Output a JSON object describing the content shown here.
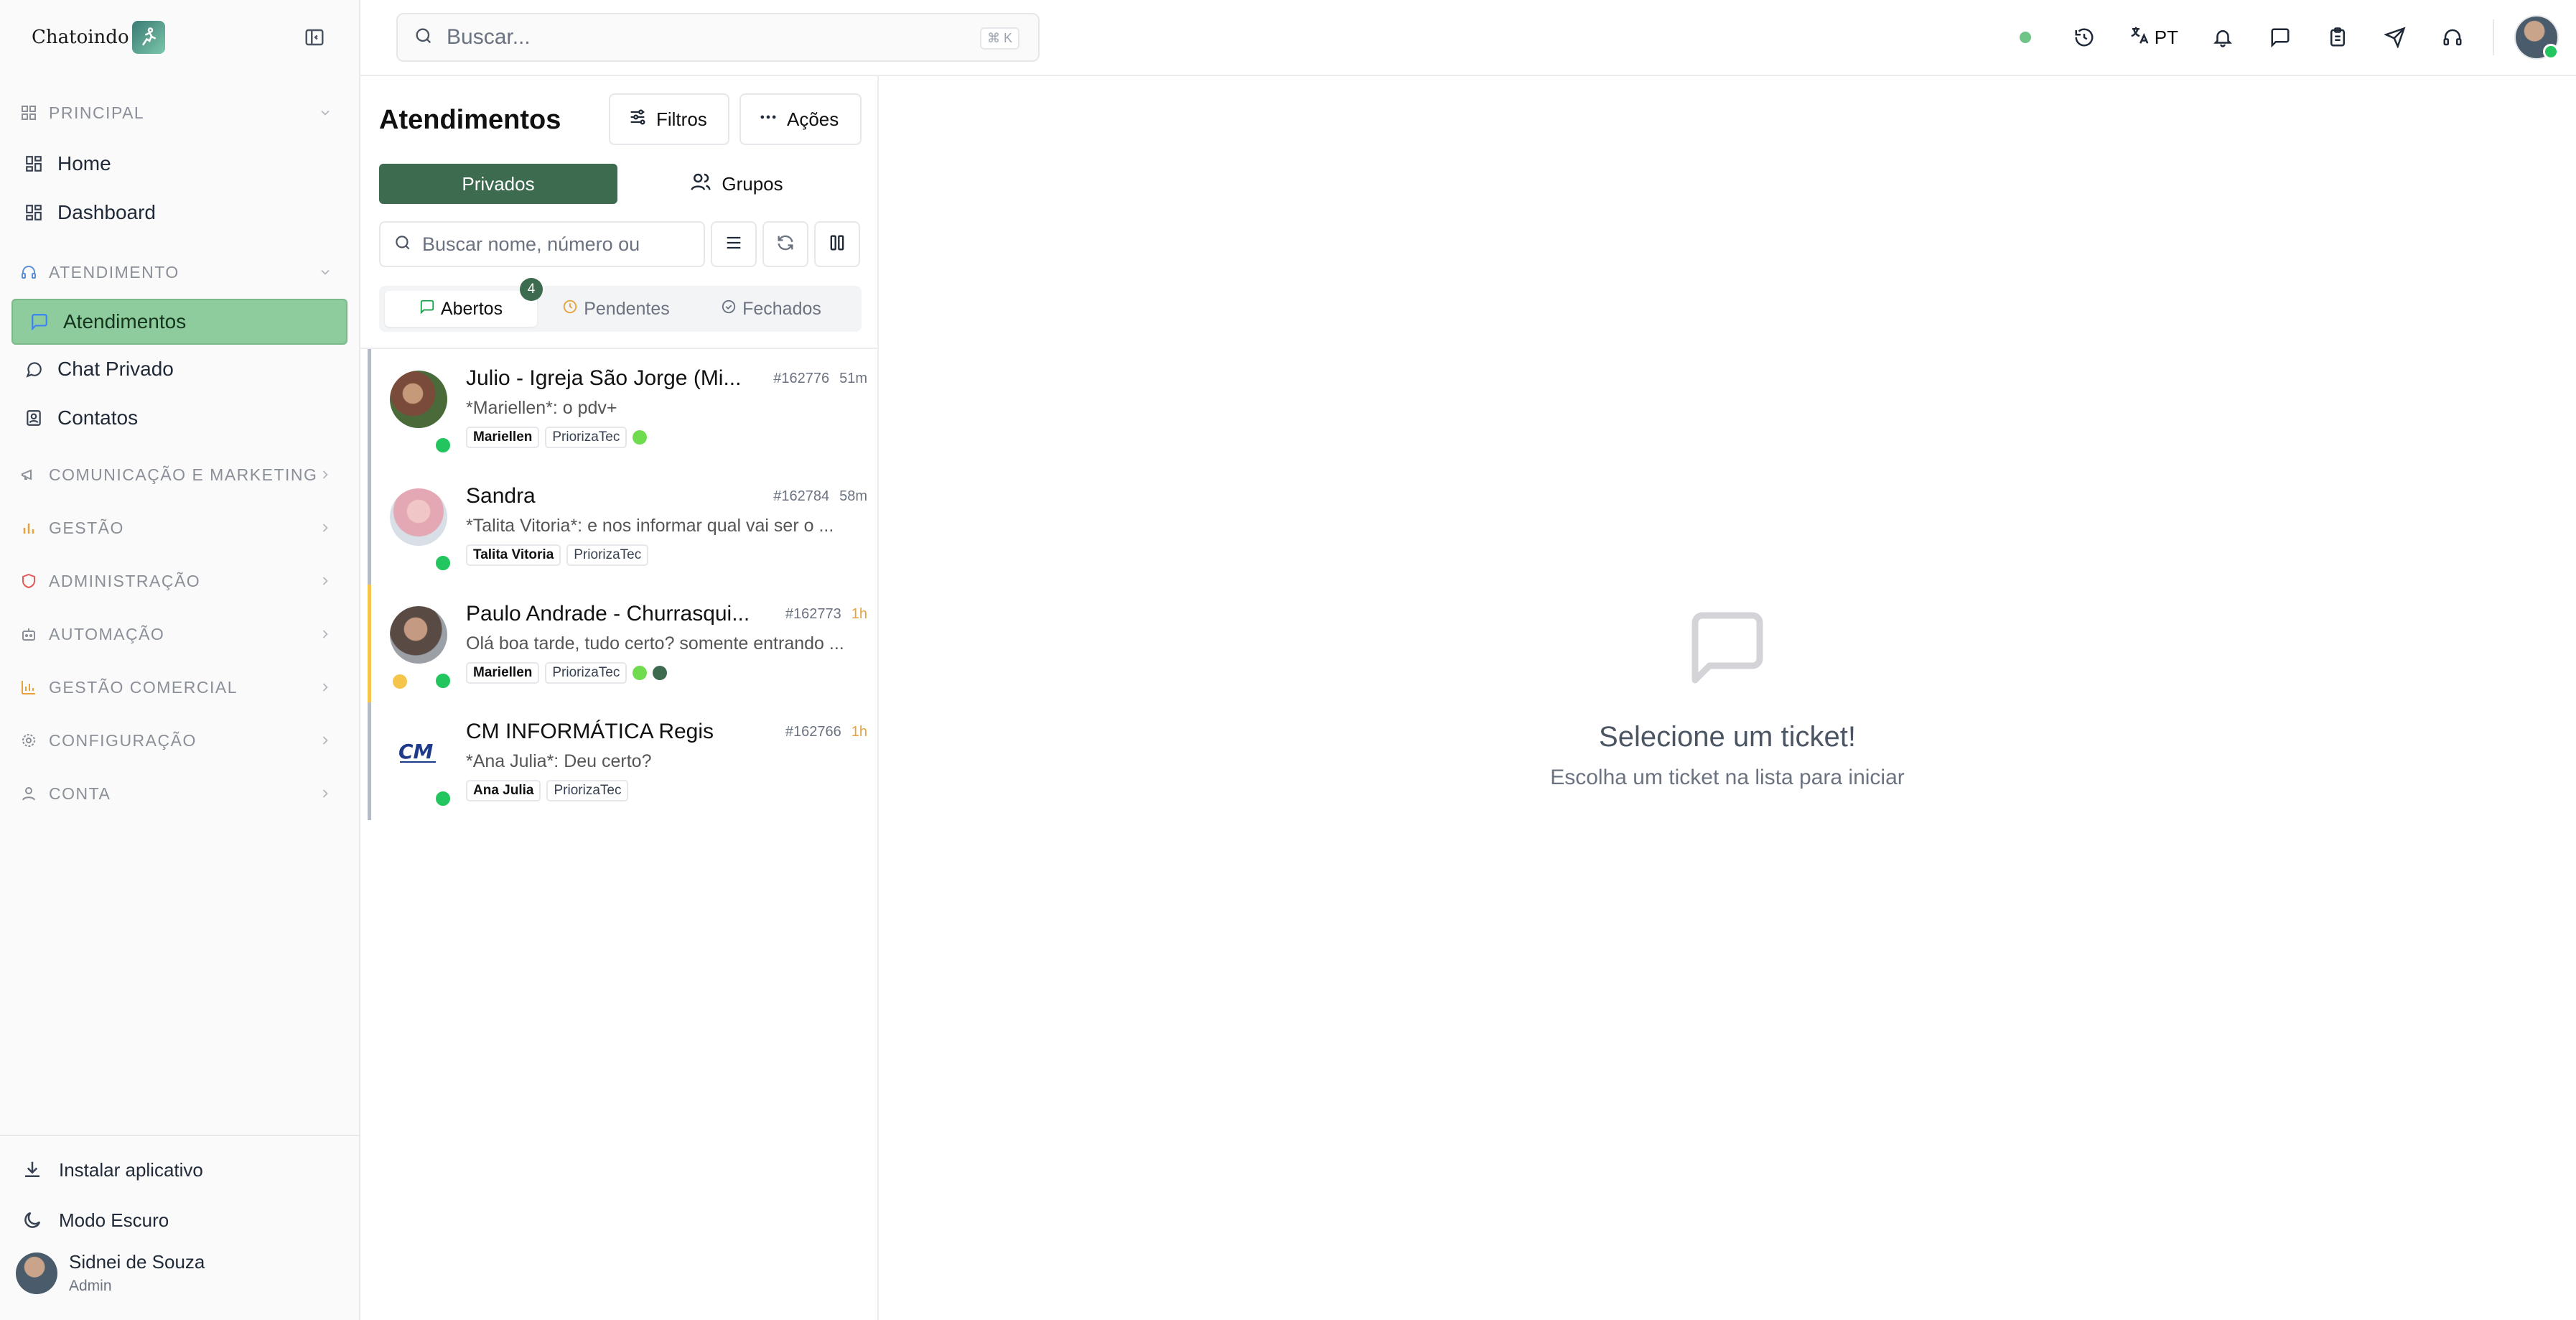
{
  "brand": {
    "name": "Chatoindo"
  },
  "search": {
    "placeholder": "Buscar...",
    "shortcut": "⌘ K"
  },
  "topbar": {
    "lang": "PT"
  },
  "sidebar": {
    "sections": [
      {
        "label": "PRINCIPAL",
        "icon": "grid-icon",
        "items": [
          "Home",
          "Dashboard"
        ]
      },
      {
        "label": "ATENDIMENTO",
        "icon": "headset-icon",
        "items": [
          "Atendimentos",
          "Chat Privado",
          "Contatos"
        ]
      },
      {
        "label": "COMUNICAÇÃO E MARKETING",
        "icon": "megaphone-icon"
      },
      {
        "label": "GESTÃO",
        "icon": "bar-chart-icon"
      },
      {
        "label": "ADMINISTRAÇÃO",
        "icon": "shield-icon"
      },
      {
        "label": "AUTOMAÇÃO",
        "icon": "robot-icon"
      },
      {
        "label": "GESTÃO COMERCIAL",
        "icon": "chart-icon"
      },
      {
        "label": "CONFIGURAÇÃO",
        "icon": "gear-icon"
      },
      {
        "label": "CONTA",
        "icon": "user-icon"
      }
    ],
    "footer": {
      "install": "Instalar aplicativo",
      "dark": "Modo Escuro"
    },
    "user": {
      "name": "Sidnei de Souza",
      "role": "Admin"
    }
  },
  "panel": {
    "title": "Atendimentos",
    "filters": "Filtros",
    "actions": "Ações",
    "tabs": {
      "private": "Privados",
      "groups": "Grupos"
    },
    "list_search_placeholder": "Buscar nome, número ou",
    "status": {
      "open": "Abertos",
      "open_count": "4",
      "pending": "Pendentes",
      "closed": "Fechados"
    },
    "tickets": [
      {
        "name": "Julio - Igreja São Jorge (Mi...",
        "id": "#162776",
        "time": "51m",
        "message": "*Mariellen*: o pdv+",
        "tags": [
          "Mariellen",
          "PriorizaTec"
        ]
      },
      {
        "name": "Sandra",
        "id": "#162784",
        "time": "58m",
        "message": "*Talita Vitoria*: e nos informar qual vai ser o ...",
        "tags": [
          "Talita Vitoria",
          "PriorizaTec"
        ]
      },
      {
        "name": "Paulo Andrade - Churrasqui...",
        "id": "#162773",
        "time": "1h",
        "message": "Olá boa tarde, tudo certo? somente entrando ...",
        "tags": [
          "Mariellen",
          "PriorizaTec"
        ]
      },
      {
        "name": "CM INFORMÁTICA Regis",
        "id": "#162766",
        "time": "1h",
        "message": "*Ana Julia*: Deu certo?",
        "tags": [
          "Ana Julia",
          "PriorizaTec"
        ]
      }
    ]
  },
  "empty": {
    "title": "Selecione um ticket!",
    "subtitle": "Escolha um ticket na lista para iniciar"
  },
  "colors": {
    "accent": "#3d6b50",
    "active_nav": "#8fcc9d",
    "online": "#22c55e",
    "warning": "#f5c54b"
  }
}
